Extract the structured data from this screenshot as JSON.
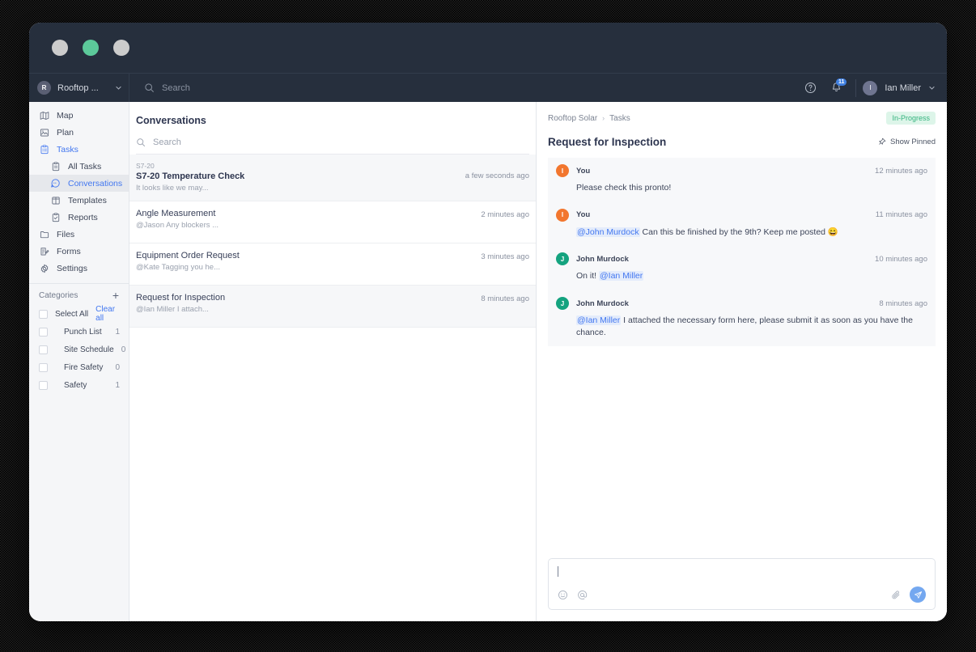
{
  "window": {
    "traffic_lights": [
      {
        "name": "window-dot-1",
        "color": "#cccccc"
      },
      {
        "name": "window-dot-2",
        "color": "#5cc99a"
      },
      {
        "name": "window-dot-3",
        "color": "#cccccc"
      }
    ]
  },
  "topnav": {
    "workspace": {
      "initial": "R",
      "name": "Rooftop ...",
      "chevron": "chevron-down-icon"
    },
    "search_placeholder": "Search",
    "help_icon": "help-circle-icon",
    "notifications": {
      "icon": "bell-icon",
      "count": "11"
    },
    "user": {
      "initial": "I",
      "name": "Ian Miller",
      "chevron": "chevron-down-icon"
    }
  },
  "sidebar": {
    "items": [
      {
        "label": "Map",
        "icon": "map-icon",
        "level": "top",
        "state": "normal"
      },
      {
        "label": "Plan",
        "icon": "plan-icon",
        "level": "top",
        "state": "normal"
      },
      {
        "label": "Tasks",
        "icon": "tasks-icon",
        "level": "top",
        "state": "active"
      },
      {
        "label": "All Tasks",
        "icon": "clipboard-icon",
        "level": "sub",
        "state": "normal"
      },
      {
        "label": "Conversations",
        "icon": "chat-bubble-icon",
        "level": "sub",
        "state": "selected"
      },
      {
        "label": "Templates",
        "icon": "templates-icon",
        "level": "sub",
        "state": "normal"
      },
      {
        "label": "Reports",
        "icon": "reports-icon",
        "level": "sub",
        "state": "normal"
      },
      {
        "label": "Files",
        "icon": "folder-icon",
        "level": "top",
        "state": "normal"
      },
      {
        "label": "Forms",
        "icon": "forms-icon",
        "level": "top",
        "state": "normal"
      },
      {
        "label": "Settings",
        "icon": "gear-icon",
        "level": "top",
        "state": "normal"
      }
    ],
    "categories": {
      "heading": "Categories",
      "add_icon": "plus-icon",
      "select_all_label": "Select All",
      "clear_all_label": "Clear all",
      "rows": [
        {
          "label": "Punch List",
          "count": "1"
        },
        {
          "label": "Site Schedule",
          "count": "0"
        },
        {
          "label": "Fire Safety",
          "count": "0"
        },
        {
          "label": "Safety",
          "count": "1"
        }
      ]
    }
  },
  "conversations": {
    "title": "Conversations",
    "search_placeholder": "Search",
    "search_icon": "search-icon",
    "items": [
      {
        "tag": "S7-20",
        "name": "S7-20 Temperature Check",
        "preview": "It looks like we may...",
        "time": "a few seconds ago",
        "active": true
      },
      {
        "tag": "",
        "name": "Angle Measurement",
        "preview": "@Jason Any blockers ...",
        "time": "2 minutes ago",
        "active": false
      },
      {
        "tag": "",
        "name": "Equipment Order Request",
        "preview": "@Kate Tagging you he...",
        "time": "3 minutes ago",
        "active": false
      },
      {
        "tag": "",
        "name": "Request for Inspection",
        "preview": "@Ian Miller I attach...",
        "time": "8 minutes ago",
        "active": false
      }
    ]
  },
  "detail": {
    "breadcrumb": [
      "Rooftop Solar",
      "Tasks"
    ],
    "status": "In-Progress",
    "status_color": "#35b37e",
    "title": "Request for Inspection",
    "show_pinned_label": "Show Pinned",
    "pin_icon": "pin-icon",
    "messages": [
      {
        "author": "You",
        "initial": "I",
        "avatar_color": "#f2762e",
        "time": "12 minutes ago",
        "mention": "",
        "text": "Please check this pronto!",
        "shaded": true
      },
      {
        "author": "You",
        "initial": "I",
        "avatar_color": "#f2762e",
        "time": "11 minutes ago",
        "mention": "@John Murdock",
        "text": " Can this be finished by the 9th? Keep me posted 😄",
        "shaded": true
      },
      {
        "author": "John Murdock",
        "initial": "J",
        "avatar_color": "#14a37f",
        "time": "10 minutes ago",
        "mention": "@Ian Miller",
        "text": "",
        "prefix": "On it! ",
        "shaded": true
      },
      {
        "author": "John Murdock",
        "initial": "J",
        "avatar_color": "#14a37f",
        "time": "8 minutes ago",
        "mention": "@Ian Miller",
        "text": " I attached the necessary form here, please submit it as soon as you have the chance.",
        "shaded": true
      }
    ],
    "composer": {
      "value": "",
      "placeholder": "",
      "emoji_icon": "emoji-smiley-icon",
      "mention_icon": "at-mention-icon",
      "attach_icon": "paperclip-icon",
      "send_icon": "send-icon"
    }
  }
}
